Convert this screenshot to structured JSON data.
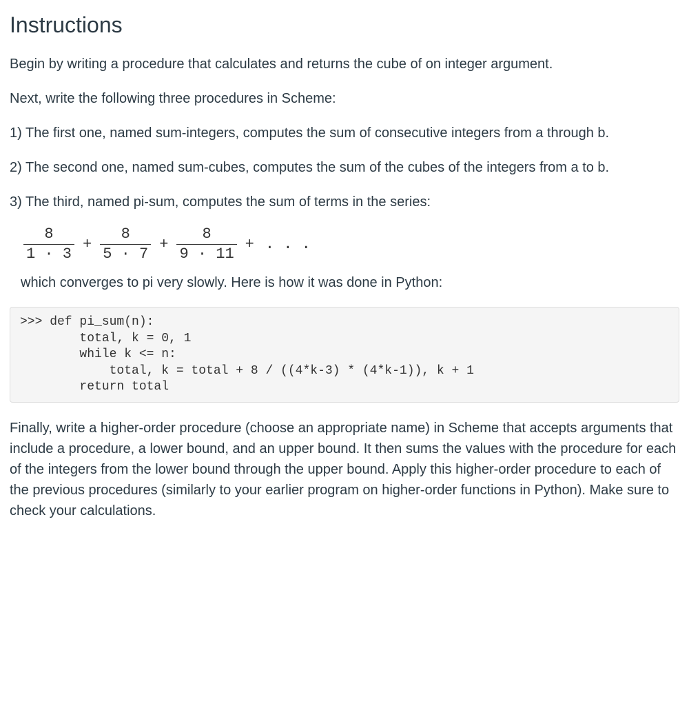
{
  "heading": "Instructions",
  "p1": "Begin by writing a procedure that calculates and returns the cube of on integer argument.",
  "p2": "Next, write the following three procedures in Scheme:",
  "p3": "1) The first one, named sum-integers, computes the sum of consecutive integers from a through b.",
  "p4": "2) The second one, named sum-cubes, computes the sum of the cubes of the integers from a to b.",
  "p5": "3) The third, named pi-sum, computes the sum of terms in the series:",
  "series": {
    "terms": [
      {
        "num": "8",
        "den": "1 · 3"
      },
      {
        "num": "8",
        "den": "5 · 7"
      },
      {
        "num": "8",
        "den": "9 · 11"
      }
    ],
    "plus": "+",
    "ellipsis": ". . ."
  },
  "p6": "which converges to pi very slowly. Here is how it was done in Python:",
  "code": ">>> def pi_sum(n):\n        total, k = 0, 1\n        while k <= n:\n            total, k = total + 8 / ((4*k-3) * (4*k-1)), k + 1\n        return total",
  "p7": "Finally, write a higher-order procedure (choose an appropriate name) in Scheme that accepts arguments that include a procedure,  a lower bound, and an upper bound. It then sums the values with the procedure for each of the integers from the lower bound through the upper bound. Apply this higher-order procedure to each of the previous procedures (similarly to your earlier program on higher-order functions in Python). Make sure to check your calculations."
}
